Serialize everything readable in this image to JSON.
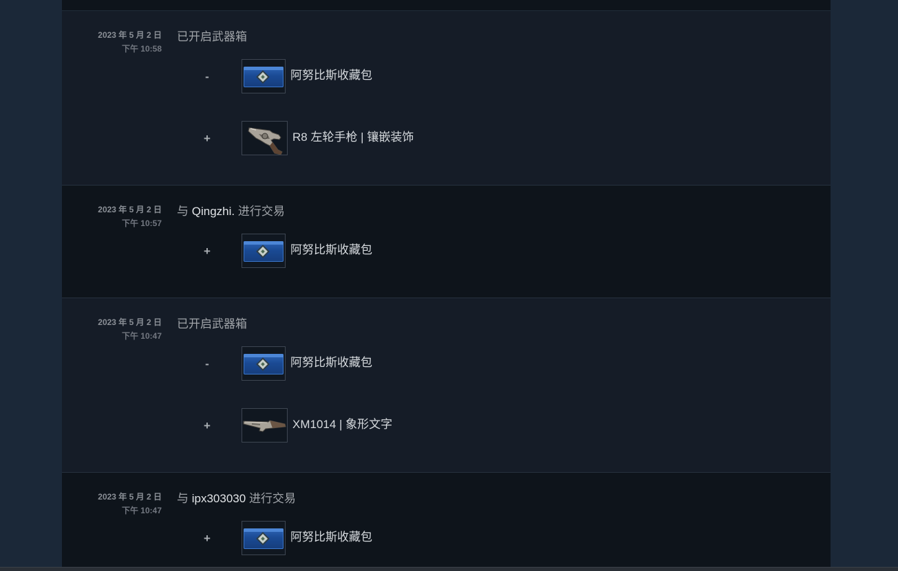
{
  "history": [
    {
      "date": "2023 年 5 月 2 日",
      "time": "下午 10:58",
      "event": "已开启武器箱",
      "items": [
        {
          "sign": "-",
          "name": "阿努比斯收藏包",
          "icon": "case-icon"
        },
        {
          "sign": "+",
          "name": "R8 左轮手枪 | 镶嵌装饰",
          "icon": "revolver-icon"
        }
      ]
    },
    {
      "date": "2023 年 5 月 2 日",
      "time": "下午 10:57",
      "event_prefix": "与",
      "partner": "Qingzhi.",
      "event_suffix": "进行交易",
      "items": [
        {
          "sign": "+",
          "name": "阿努比斯收藏包",
          "icon": "case-icon"
        }
      ]
    },
    {
      "date": "2023 年 5 月 2 日",
      "time": "下午 10:47",
      "event": "已开启武器箱",
      "items": [
        {
          "sign": "-",
          "name": "阿努比斯收藏包",
          "icon": "case-icon"
        },
        {
          "sign": "+",
          "name": "XM1014 | 象形文字",
          "icon": "shotgun-icon"
        }
      ]
    },
    {
      "date": "2023 年 5 月 2 日",
      "time": "下午 10:47",
      "event_prefix": "与",
      "partner": "ipx303030",
      "event_suffix": "进行交易",
      "items": [
        {
          "sign": "+",
          "name": "阿努比斯收藏包",
          "icon": "case-icon"
        }
      ]
    }
  ],
  "colors": {
    "page_bg": "#1b2838",
    "row_light": "#151c27",
    "row_dark": "#0e141b",
    "partner_text": "#e1e4e7",
    "case_blue": "#1a4a94"
  }
}
